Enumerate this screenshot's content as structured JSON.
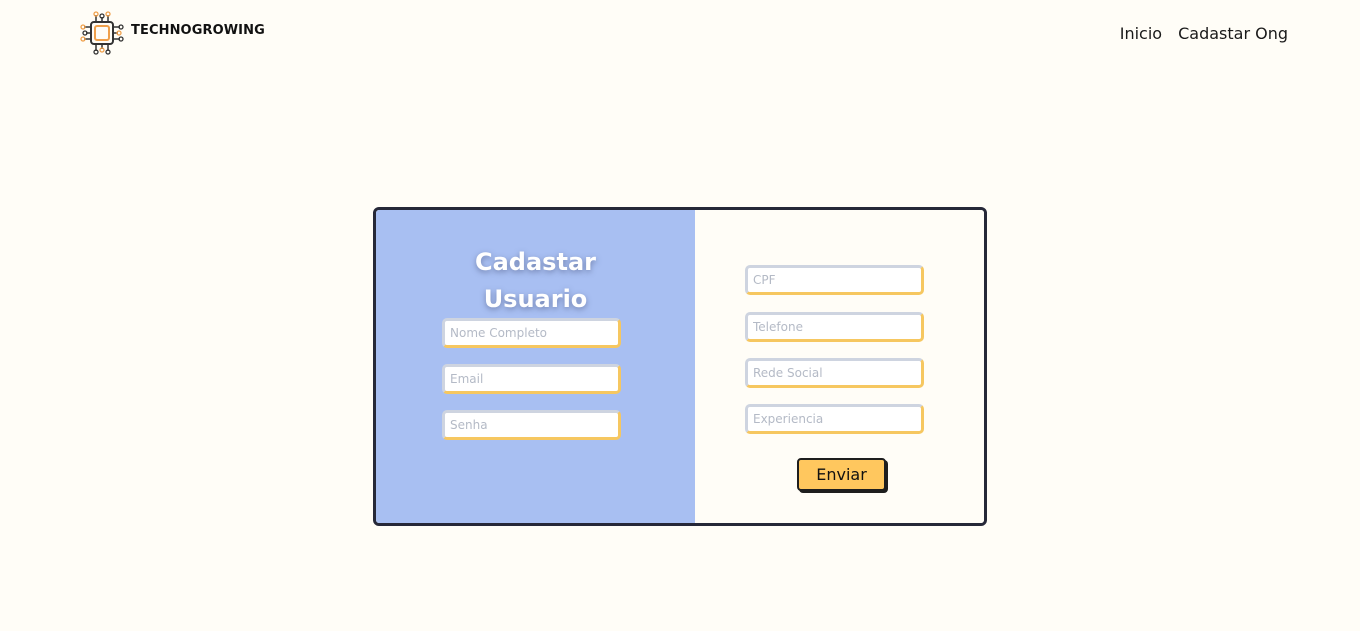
{
  "header": {
    "brand": {
      "name": "TECHNOGROWING",
      "logo_icon": "circuit-chip-icon",
      "logo_colors": {
        "chip": "#333333",
        "accent": "#f0a04b"
      }
    },
    "nav": {
      "items": [
        {
          "label": "Inicio"
        },
        {
          "label": "Cadastar Ong"
        }
      ]
    }
  },
  "form": {
    "title_line1": "Cadastar",
    "title_line2": "Usuario",
    "left_fields": [
      {
        "name": "nome",
        "value": "",
        "placeholder": "Nome Completo"
      },
      {
        "name": "email",
        "value": "",
        "placeholder": "Email"
      },
      {
        "name": "senha",
        "value": "",
        "placeholder": "Senha"
      }
    ],
    "right_fields": [
      {
        "name": "cpf",
        "value": "",
        "placeholder": "CPF"
      },
      {
        "name": "telefone",
        "value": "",
        "placeholder": "Telefone"
      },
      {
        "name": "rede_social",
        "value": "",
        "placeholder": "Rede Social"
      },
      {
        "name": "experiencia",
        "value": "",
        "placeholder": "Experiencia"
      }
    ],
    "submit_label": "Enviar"
  },
  "colors": {
    "page_background": "#fffdf7",
    "left_panel": "#a8bff2",
    "card_border": "#262838",
    "field_accent": "#f6c760",
    "button": "#ffc75e"
  }
}
